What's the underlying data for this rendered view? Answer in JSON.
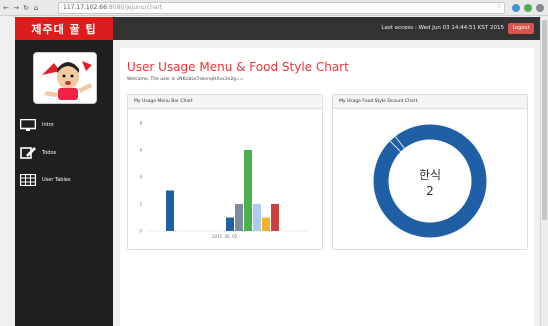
{
  "browser": {
    "url_host": "117.17.102.66",
    "url_path": ":8080/jejunu/chart"
  },
  "sidebar": {
    "brand": "제주대 꿀 팁",
    "items": [
      {
        "label": "Intro",
        "icon": "monitor-icon"
      },
      {
        "label": "Todos",
        "icon": "edit-icon"
      },
      {
        "label": "User Tables",
        "icon": "table-icon"
      }
    ]
  },
  "topbar": {
    "last_access": "Last access : Wed Jun 03 14:44:51 KST 2015",
    "logout_label": "Logout"
  },
  "page": {
    "title": "User Usage Menu & Food Style Chart",
    "welcome": "Welcome, The user is vNKUaLe7sknnqHXvx3v2g=="
  },
  "panels": {
    "bar_title": "My Usage Menu Bar Chart",
    "donut_title": "My Usage Food Style Dcount Chart"
  },
  "chart_data": [
    {
      "type": "bar",
      "title": "My Usage Menu Bar Chart",
      "ylim": [
        0,
        8
      ],
      "yticks": [
        0,
        2,
        4,
        6,
        8
      ],
      "xtick_label": "2015. 06. 02 -",
      "bars": [
        {
          "value": 3,
          "color": "#1f5fa6"
        },
        {
          "value": 1,
          "color": "#1f5fa6"
        },
        {
          "value": 2,
          "color": "#7f8c9a"
        },
        {
          "value": 6,
          "color": "#4caf50"
        },
        {
          "value": 2,
          "color": "#a8cdf0"
        },
        {
          "value": 1,
          "color": "#f0b030"
        },
        {
          "value": 2,
          "color": "#c84040"
        }
      ],
      "grid": false
    },
    {
      "type": "pie",
      "title": "My Usage Food Style Dcount Chart",
      "center_label": "한식",
      "center_value": "2",
      "slices": [
        {
          "label": "한식",
          "value": 2,
          "color": "#1f5fa6"
        }
      ]
    }
  ],
  "colors": {
    "brand_red": "#dd1c1c",
    "title_red": "#e33333",
    "donut_blue": "#1f5fa6"
  }
}
